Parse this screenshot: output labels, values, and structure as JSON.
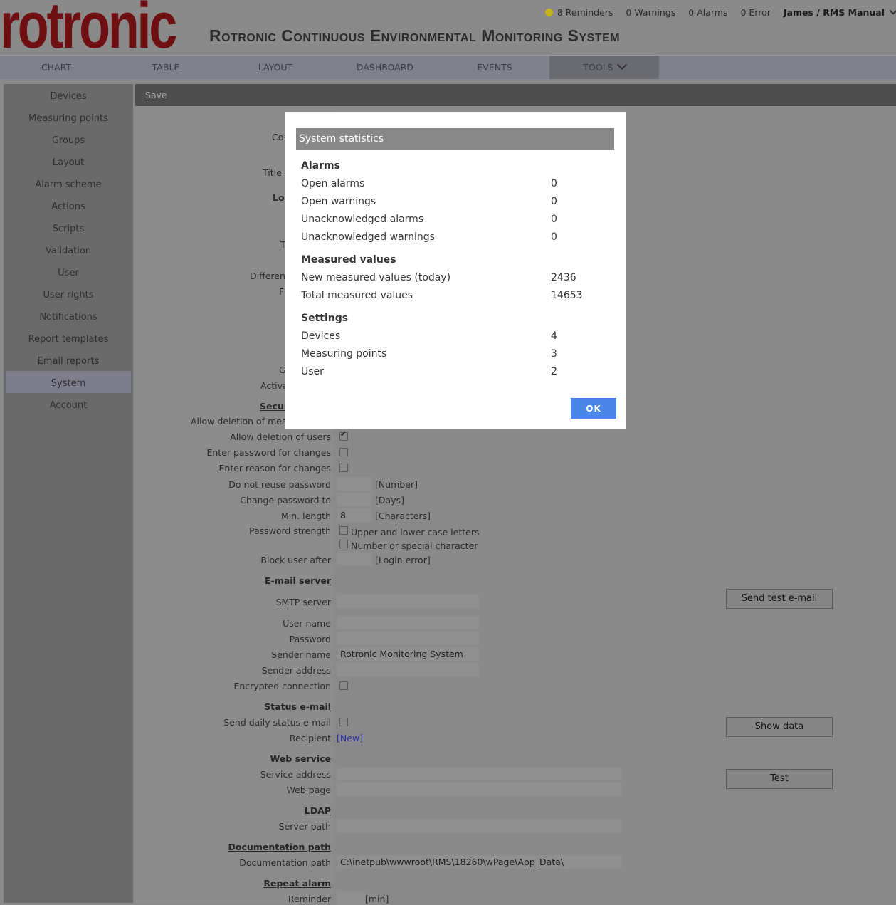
{
  "brand": {
    "logo_text": "rotronic",
    "app_title": "Rotronic Continuous Environmental Monitoring System"
  },
  "status": {
    "reminders": "8 Reminders",
    "warnings": "0 Warnings",
    "alarms": "0 Alarms",
    "errors": "0 Error",
    "user": "James / RMS Manual"
  },
  "nav": [
    {
      "label": "CHART"
    },
    {
      "label": "TABLE"
    },
    {
      "label": "LAYOUT"
    },
    {
      "label": "DASHBOARD"
    },
    {
      "label": "EVENTS"
    },
    {
      "label": "TOOLS",
      "active": true
    }
  ],
  "sidebar": [
    {
      "label": "Devices"
    },
    {
      "label": "Measuring points"
    },
    {
      "label": "Groups"
    },
    {
      "label": "Layout"
    },
    {
      "label": "Alarm scheme"
    },
    {
      "label": "Actions"
    },
    {
      "label": "Scripts"
    },
    {
      "label": "Validation"
    },
    {
      "label": "User"
    },
    {
      "label": "User rights"
    },
    {
      "label": "Notifications"
    },
    {
      "label": "Report templates"
    },
    {
      "label": "Email reports"
    },
    {
      "label": "System",
      "active": true
    },
    {
      "label": "Account"
    }
  ],
  "toolbar": {
    "save_label": "Save"
  },
  "fragments": {
    "co": "Co",
    "title_l": "Title l",
    "loc": "Loc",
    "t": "T",
    "differ": "Different",
    "f": "F",
    "g": "G",
    "activ": "Activa",
    "secur": "Secur",
    "allow_meas": "Allow deletion of meas"
  },
  "form": {
    "allow_delete_users": "Allow deletion of users",
    "enter_password": "Enter password for changes",
    "enter_reason": "Enter reason for changes",
    "no_reuse": "Do not reuse password",
    "no_reuse_unit": "[Number]",
    "change_pw": "Change password to",
    "change_pw_unit": "[Days]",
    "min_length": "Min. length",
    "min_length_value": "8",
    "min_length_unit": "[Characters]",
    "pw_strength": "Password strength",
    "pw_opt1": "Upper and lower case letters",
    "pw_opt2": "Number or special character",
    "block_user": "Block user after",
    "block_user_unit": "[Login error]",
    "email_server": "E-mail server",
    "smtp": "SMTP server",
    "user_name": "User name",
    "password": "Password",
    "sender_name": "Sender name",
    "sender_name_value": "Rotronic Monitoring System",
    "sender_address": "Sender address",
    "encrypted": "Encrypted connection",
    "send_test": "Send test e-mail",
    "status_email": "Status e-mail",
    "send_daily": "Send daily status e-mail",
    "recipient": "Recipient",
    "recipient_new": "[New]",
    "show_data": "Show data",
    "web_service": "Web service",
    "service_address": "Service address",
    "web_page": "Web page",
    "test": "Test",
    "ldap": "LDAP",
    "server_path": "Server path",
    "doc_path_section": "Documentation path",
    "doc_path": "Documentation path",
    "doc_path_value": "C:\\inetpub\\wwwroot\\RMS\\18260\\wPage\\App_Data\\",
    "repeat_alarm": "Repeat alarm",
    "reminder": "Reminder",
    "reminder_unit": "[min]"
  },
  "modal": {
    "title": "System statistics",
    "alarms_title": "Alarms",
    "alarms": [
      {
        "label": "Open alarms",
        "value": "0"
      },
      {
        "label": "Open warnings",
        "value": "0"
      },
      {
        "label": "Unacknowledged alarms",
        "value": "0"
      },
      {
        "label": "Unacknowledged warnings",
        "value": "0"
      }
    ],
    "measured_title": "Measured values",
    "measured": [
      {
        "label": "New measured values (today)",
        "value": "2436"
      },
      {
        "label": "Total measured values",
        "value": "14653"
      }
    ],
    "settings_title": "Settings",
    "settings": [
      {
        "label": "Devices",
        "value": "4"
      },
      {
        "label": "Measuring points",
        "value": "3"
      },
      {
        "label": "User",
        "value": "2"
      }
    ],
    "ok": "OK"
  }
}
